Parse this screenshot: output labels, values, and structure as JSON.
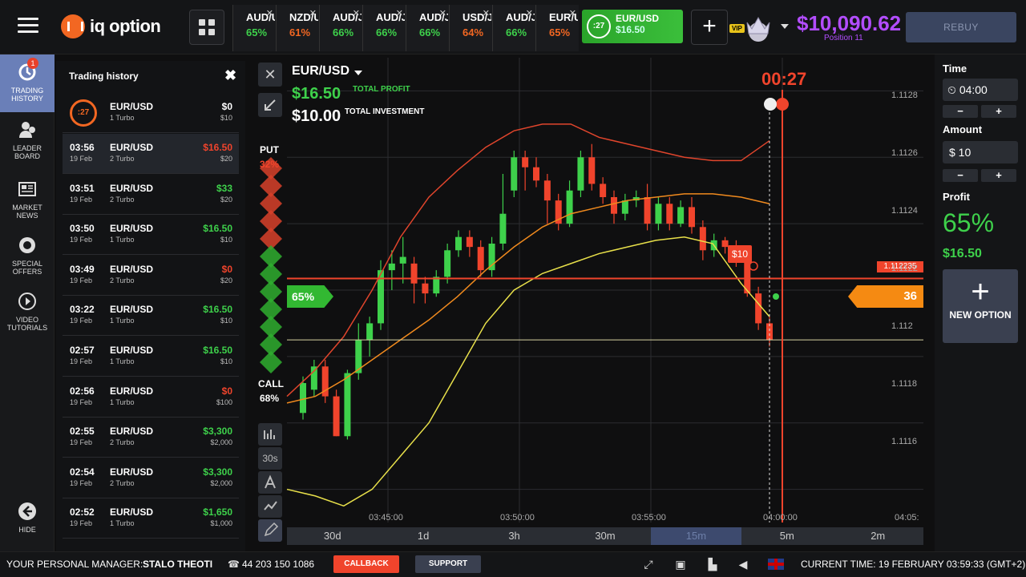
{
  "app": {
    "name": "iq option"
  },
  "assets": [
    {
      "name": "AUD/U",
      "pct": "65%",
      "color": "#3ed14b"
    },
    {
      "name": "NZD/U",
      "pct": "61%",
      "color": "#f26722"
    },
    {
      "name": "AUD/J",
      "pct": "66%",
      "color": "#3ed14b"
    },
    {
      "name": "AUD/J",
      "pct": "66%",
      "color": "#3ed14b"
    },
    {
      "name": "AUD/J",
      "pct": "66%",
      "color": "#3ed14b"
    },
    {
      "name": "USD/J",
      "pct": "64%",
      "color": "#f26722"
    },
    {
      "name": "AUD/J",
      "pct": "66%",
      "color": "#3ed14b"
    },
    {
      "name": "EUR/U",
      "pct": "65%",
      "color": "#f26722"
    }
  ],
  "active_asset": {
    "timer": ":27",
    "name": "EUR/USD",
    "value": "$16.50"
  },
  "account": {
    "vip": "VIP",
    "balance": "$10,090.62",
    "position": "Position 11",
    "rebuy": "REBUY"
  },
  "nav": [
    {
      "label1": "TRADING",
      "label2": "HISTORY",
      "badge": "1",
      "icon": "history-icon"
    },
    {
      "label1": "LEADER",
      "label2": "BOARD",
      "icon": "leaderboard-icon"
    },
    {
      "label1": "MARKET",
      "label2": "NEWS",
      "icon": "news-icon"
    },
    {
      "label1": "SPECIAL",
      "label2": "OFFERS",
      "icon": "offers-icon"
    },
    {
      "label1": "VIDEO",
      "label2": "TUTORIALS",
      "icon": "play-icon"
    },
    {
      "label1": "HIDE",
      "label2": "",
      "icon": "back-arrow-icon"
    }
  ],
  "history": {
    "title": "Trading history",
    "active": {
      "timer": ":27",
      "pair": "EUR/USD",
      "kind": "1 Turbo",
      "result": "$0",
      "invest": "$10"
    },
    "rows": [
      {
        "time": "03:56",
        "date": "19 Feb",
        "pair": "EUR/USD",
        "kind": "2 Turbo",
        "result": "$16.50",
        "invest": "$20",
        "color": "red"
      },
      {
        "time": "03:51",
        "date": "19 Feb",
        "pair": "EUR/USD",
        "kind": "2 Turbo",
        "result": "$33",
        "invest": "$20",
        "color": "green"
      },
      {
        "time": "03:50",
        "date": "19 Feb",
        "pair": "EUR/USD",
        "kind": "1 Turbo",
        "result": "$16.50",
        "invest": "$10",
        "color": "green"
      },
      {
        "time": "03:49",
        "date": "19 Feb",
        "pair": "EUR/USD",
        "kind": "2 Turbo",
        "result": "$0",
        "invest": "$20",
        "color": "red"
      },
      {
        "time": "03:22",
        "date": "19 Feb",
        "pair": "EUR/USD",
        "kind": "1 Turbo",
        "result": "$16.50",
        "invest": "$10",
        "color": "green"
      },
      {
        "time": "02:57",
        "date": "19 Feb",
        "pair": "EUR/USD",
        "kind": "1 Turbo",
        "result": "$16.50",
        "invest": "$10",
        "color": "green"
      },
      {
        "time": "02:56",
        "date": "19 Feb",
        "pair": "EUR/USD",
        "kind": "1 Turbo",
        "result": "$0",
        "invest": "$100",
        "color": "red"
      },
      {
        "time": "02:55",
        "date": "19 Feb",
        "pair": "EUR/USD",
        "kind": "2 Turbo",
        "result": "$3,300",
        "invest": "$2,000",
        "color": "green"
      },
      {
        "time": "02:54",
        "date": "19 Feb",
        "pair": "EUR/USD",
        "kind": "2 Turbo",
        "result": "$3,300",
        "invest": "$2,000",
        "color": "green"
      },
      {
        "time": "02:52",
        "date": "19 Feb",
        "pair": "EUR/USD",
        "kind": "1 Turbo",
        "result": "$1,650",
        "invest": "$1,000",
        "color": "green"
      }
    ]
  },
  "chart": {
    "pair": "EUR/USD",
    "total_profit": "$16.50",
    "total_profit_label": "TOTAL PROFIT",
    "total_investment": "$10.00",
    "total_investment_label": "TOTAL INVESTMENT",
    "countdown": "00:27",
    "put_label": "PUT",
    "put_pct": "32%",
    "call_label": "CALL",
    "call_pct": "68%",
    "payout_tag": "65%",
    "profit_tag": "$10",
    "current_tag": "36",
    "red_line_tag": "1.112235",
    "y_ticks": [
      "1.1128",
      "1.1126",
      "1.1124",
      "1.1122",
      "1.112",
      "1.1118",
      "1.1116"
    ],
    "x_ticks": [
      "03:45:00",
      "03:50:00",
      "03:55:00",
      "04:00:00",
      "04:05:"
    ],
    "side_tools": [
      "30s"
    ],
    "timeframes": [
      "30d",
      "1d",
      "3h",
      "30m",
      "15m",
      "5m",
      "2m"
    ],
    "active_timeframe": "15m"
  },
  "chart_data": {
    "type": "candlestick",
    "pair": "EUR/USD",
    "ylim": [
      1.1115,
      1.1129
    ],
    "candles": [
      {
        "o": 1.11183,
        "c": 1.11192,
        "h": 1.11194,
        "l": 1.11181
      },
      {
        "o": 1.1119,
        "c": 1.11197,
        "h": 1.11199,
        "l": 1.11188
      },
      {
        "o": 1.11197,
        "c": 1.11188,
        "h": 1.11199,
        "l": 1.11186
      },
      {
        "o": 1.11188,
        "c": 1.11176,
        "h": 1.1119,
        "l": 1.11176
      },
      {
        "o": 1.11176,
        "c": 1.11195,
        "h": 1.11196,
        "l": 1.11175
      },
      {
        "o": 1.11195,
        "c": 1.11205,
        "h": 1.1121,
        "l": 1.11193
      },
      {
        "o": 1.11205,
        "c": 1.1121,
        "h": 1.11212,
        "l": 1.112
      },
      {
        "o": 1.1121,
        "c": 1.11226,
        "h": 1.11229,
        "l": 1.11208
      },
      {
        "o": 1.11226,
        "c": 1.11228,
        "h": 1.11232,
        "l": 1.1122
      },
      {
        "o": 1.11228,
        "c": 1.1123,
        "h": 1.11236,
        "l": 1.11222
      },
      {
        "o": 1.11228,
        "c": 1.11222,
        "h": 1.1123,
        "l": 1.11216
      },
      {
        "o": 1.11222,
        "c": 1.11219,
        "h": 1.11224,
        "l": 1.11216
      },
      {
        "o": 1.11219,
        "c": 1.11224,
        "h": 1.11226,
        "l": 1.11218
      },
      {
        "o": 1.11224,
        "c": 1.11232,
        "h": 1.11234,
        "l": 1.11222
      },
      {
        "o": 1.11232,
        "c": 1.11236,
        "h": 1.11238,
        "l": 1.1123
      },
      {
        "o": 1.11236,
        "c": 1.11233,
        "h": 1.11238,
        "l": 1.1123
      },
      {
        "o": 1.11233,
        "c": 1.11226,
        "h": 1.11235,
        "l": 1.11224
      },
      {
        "o": 1.11226,
        "c": 1.11234,
        "h": 1.11236,
        "l": 1.11224
      },
      {
        "o": 1.11234,
        "c": 1.11243,
        "h": 1.11255,
        "l": 1.11232
      },
      {
        "o": 1.1125,
        "c": 1.1126,
        "h": 1.11262,
        "l": 1.11248
      },
      {
        "o": 1.1126,
        "c": 1.11257,
        "h": 1.11262,
        "l": 1.1125
      },
      {
        "o": 1.11257,
        "c": 1.11253,
        "h": 1.1126,
        "l": 1.11251
      },
      {
        "o": 1.11253,
        "c": 1.11247,
        "h": 1.11255,
        "l": 1.1124
      },
      {
        "o": 1.11247,
        "c": 1.1124,
        "h": 1.11249,
        "l": 1.11238
      },
      {
        "o": 1.1124,
        "c": 1.1125,
        "h": 1.11253,
        "l": 1.11239
      },
      {
        "o": 1.1125,
        "c": 1.1126,
        "h": 1.11262,
        "l": 1.11248
      },
      {
        "o": 1.1126,
        "c": 1.11252,
        "h": 1.11264,
        "l": 1.1125
      },
      {
        "o": 1.11252,
        "c": 1.11248,
        "h": 1.11254,
        "l": 1.11246
      },
      {
        "o": 1.11248,
        "c": 1.11243,
        "h": 1.1125,
        "l": 1.1124
      },
      {
        "o": 1.11243,
        "c": 1.11247,
        "h": 1.11249,
        "l": 1.11241
      },
      {
        "o": 1.11247,
        "c": 1.11248,
        "h": 1.1125,
        "l": 1.11245
      },
      {
        "o": 1.11248,
        "c": 1.1124,
        "h": 1.11252,
        "l": 1.11238
      },
      {
        "o": 1.1124,
        "c": 1.11246,
        "h": 1.11248,
        "l": 1.11238
      },
      {
        "o": 1.11246,
        "c": 1.1124,
        "h": 1.11248,
        "l": 1.11238
      },
      {
        "o": 1.1124,
        "c": 1.11245,
        "h": 1.11247,
        "l": 1.11239
      },
      {
        "o": 1.11245,
        "c": 1.11239,
        "h": 1.11248,
        "l": 1.11237
      },
      {
        "o": 1.11239,
        "c": 1.11232,
        "h": 1.11241,
        "l": 1.11229
      },
      {
        "o": 1.11232,
        "c": 1.11235,
        "h": 1.11237,
        "l": 1.1123
      },
      {
        "o": 1.11235,
        "c": 1.11233,
        "h": 1.11236,
        "l": 1.11231
      },
      {
        "o": 1.11233,
        "c": 1.11229,
        "h": 1.11235,
        "l": 1.11227
      },
      {
        "o": 1.11229,
        "c": 1.11219,
        "h": 1.1123,
        "l": 1.11218
      },
      {
        "o": 1.11219,
        "c": 1.1121,
        "h": 1.11221,
        "l": 1.11208
      },
      {
        "o": 1.1121,
        "c": 1.11205,
        "h": 1.11212,
        "l": 1.11203
      }
    ],
    "upper_band": [
      1.11188,
      1.11196,
      1.11206,
      1.1122,
      1.11236,
      1.11248,
      1.11256,
      1.11263,
      1.11268,
      1.1127,
      1.1127,
      1.11266,
      1.11264,
      1.11262,
      1.1126,
      1.11259,
      1.11259,
      1.11265
    ],
    "middle_band": [
      1.11186,
      1.11188,
      1.11193,
      1.11199,
      1.11205,
      1.11211,
      1.11218,
      1.11226,
      1.11233,
      1.11239,
      1.11243,
      1.11245,
      1.11247,
      1.11248,
      1.11249,
      1.11249,
      1.11248,
      1.11246
    ],
    "lower_band": [
      1.1116,
      1.11158,
      1.11155,
      1.1116,
      1.1117,
      1.1118,
      1.11195,
      1.1121,
      1.1122,
      1.11225,
      1.11228,
      1.11231,
      1.11233,
      1.11235,
      1.11236,
      1.11234,
      1.11222,
      1.11212
    ],
    "red_line": 1.112235,
    "current_price": 1.11205
  },
  "right": {
    "time_label": "Time",
    "time_value": "04:00",
    "amount_label": "Amount",
    "amount_value": "$ 10",
    "profit_label": "Profit",
    "profit_pct": "65%",
    "profit_value": "$16.50",
    "new_option": "NEW OPTION",
    "minus": "−",
    "plus": "+"
  },
  "bottom": {
    "manager_label": "YOUR PERSONAL MANAGER:",
    "manager_name": "STALO THEOTI",
    "phone": "44 203 150 1086",
    "callback": "CALLBACK",
    "support": "SUPPORT",
    "current_time": "CURRENT TIME: 19 FEBRUARY 03:59:33 (GMT+2)"
  }
}
